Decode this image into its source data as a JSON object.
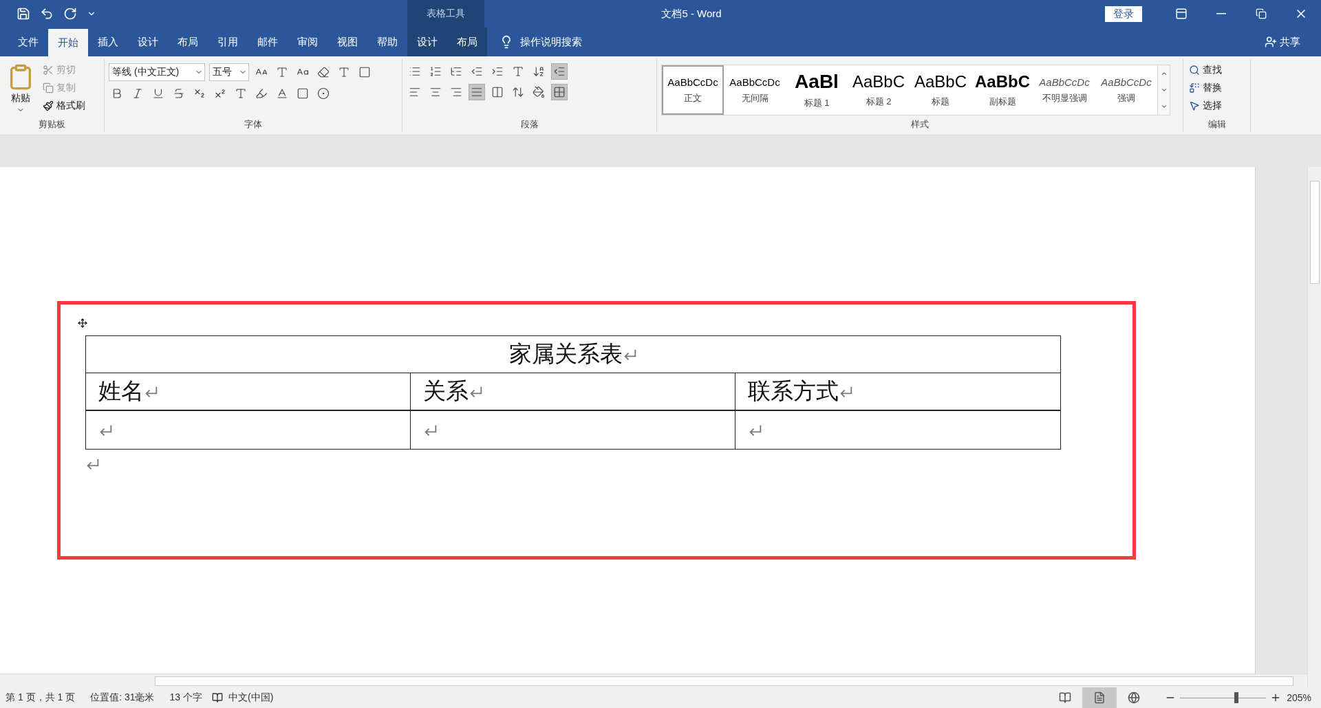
{
  "window": {
    "context_group": "表格工具",
    "title": "文档5 - Word",
    "sign_in": "登录"
  },
  "tabs": [
    {
      "label": "文件",
      "selected": false
    },
    {
      "label": "开始",
      "selected": true
    },
    {
      "label": "插入",
      "selected": false
    },
    {
      "label": "设计",
      "selected": false
    },
    {
      "label": "布局",
      "selected": false
    },
    {
      "label": "引用",
      "selected": false
    },
    {
      "label": "邮件",
      "selected": false
    },
    {
      "label": "审阅",
      "selected": false
    },
    {
      "label": "视图",
      "selected": false
    },
    {
      "label": "帮助",
      "selected": false
    }
  ],
  "context_tabs": [
    {
      "label": "设计",
      "selected": false
    },
    {
      "label": "布局",
      "selected": false
    }
  ],
  "tell_me": "操作说明搜索",
  "share": "共享",
  "clipboard": {
    "paste": "粘贴",
    "items": [
      {
        "label": "剪切",
        "disabled": true
      },
      {
        "label": "复制",
        "disabled": true
      },
      {
        "label": "格式刷",
        "disabled": false
      }
    ],
    "label": "剪贴板"
  },
  "font": {
    "font_name": "等线 (中文正文)",
    "font_size": "五号",
    "label": "字体"
  },
  "paragraph": {
    "label": "段落"
  },
  "styles": {
    "label": "样式",
    "items": [
      {
        "preview": "AaBbCcDc",
        "name": "正文",
        "kind": "normal",
        "selected": true
      },
      {
        "preview": "AaBbCcDc",
        "name": "无间隔",
        "kind": "normal",
        "selected": false
      },
      {
        "preview": "AaBl",
        "name": "标题 1",
        "kind": "heading1",
        "selected": false
      },
      {
        "preview": "AaBbC",
        "name": "标题 2",
        "kind": "heading2",
        "selected": false
      },
      {
        "preview": "AaBbC",
        "name": "标题",
        "kind": "title",
        "selected": false
      },
      {
        "preview": "AaBbC",
        "name": "副标题",
        "kind": "subtitle",
        "selected": false
      },
      {
        "preview": "AaBbCcDc",
        "name": "不明显强调",
        "kind": "emphasis",
        "selected": false
      },
      {
        "preview": "AaBbCcDc",
        "name": "强调",
        "kind": "emphasis",
        "selected": false
      }
    ]
  },
  "editing": {
    "label": "编辑",
    "items": [
      "查找",
      "替换",
      "选择"
    ]
  },
  "table": {
    "title": "家属关系表",
    "header": [
      "姓名",
      "关系",
      "联系方式"
    ],
    "rows": [
      [
        "",
        "",
        ""
      ]
    ]
  },
  "status_bar": {
    "page": "第 1 页，共 1 页",
    "position": "位置值: 31毫米",
    "words": "13 个字",
    "language": "中文(中国)",
    "views": [
      {
        "kind": "read",
        "selected": false
      },
      {
        "kind": "print",
        "selected": true
      },
      {
        "kind": "web",
        "selected": false
      }
    ],
    "zoom": {
      "level": 0.63,
      "reading": "205%"
    }
  }
}
